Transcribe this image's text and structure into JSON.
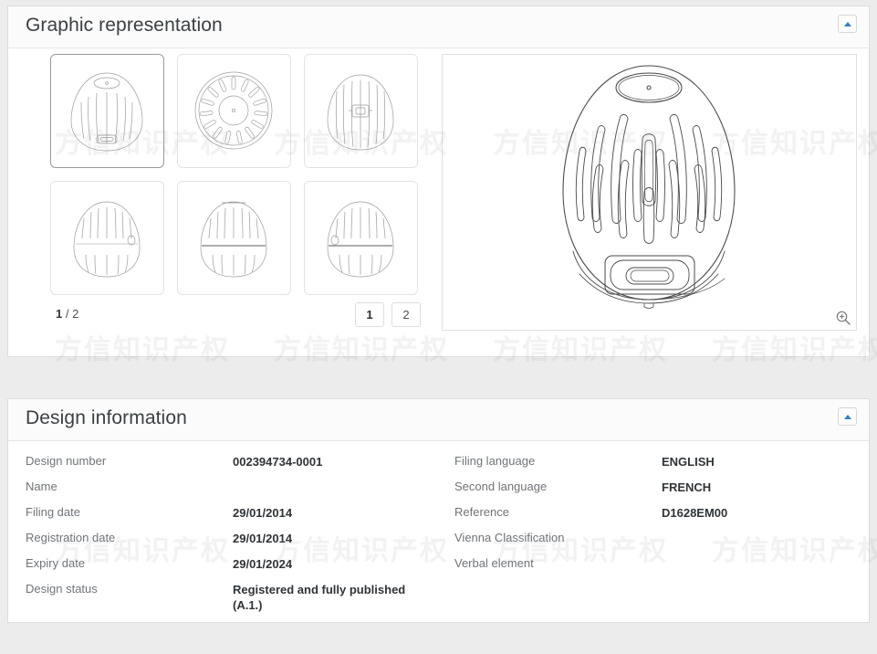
{
  "watermark": {
    "text": "方信知识产权"
  },
  "graphic_panel": {
    "title": "Graphic representation",
    "collapse_icon": "caret-up-icon",
    "page_count_current": "1",
    "page_count_separator": " / ",
    "page_count_total": "2",
    "pager": [
      {
        "label": "1",
        "active": true
      },
      {
        "label": "2",
        "active": false
      }
    ],
    "zoom_icon": "magnifier-plus-icon",
    "thumbnails": [
      {
        "name": "thumbnail-1-perspective-view",
        "selected": true,
        "view": "perspective"
      },
      {
        "name": "thumbnail-2-top-view",
        "selected": false,
        "view": "top"
      },
      {
        "name": "thumbnail-3-front-view",
        "selected": false,
        "view": "front"
      },
      {
        "name": "thumbnail-4-side-view",
        "selected": false,
        "view": "side"
      },
      {
        "name": "thumbnail-5-back-view",
        "selected": false,
        "view": "back"
      },
      {
        "name": "thumbnail-6-other-side-view",
        "selected": false,
        "view": "side2"
      }
    ],
    "main_image_alt": "design-drawing-egg-shaped-device-perspective"
  },
  "design_panel": {
    "title": "Design information",
    "collapse_icon": "caret-up-icon",
    "left_fields": [
      {
        "label": "Design number",
        "value": "002394734-0001"
      },
      {
        "label": "Name",
        "value": ""
      },
      {
        "label": "Filing date",
        "value": "29/01/2014"
      },
      {
        "label": "Registration date",
        "value": "29/01/2014"
      },
      {
        "label": "Expiry date",
        "value": "29/01/2024"
      },
      {
        "label": "Design status",
        "value": "Registered and fully published (A.1.)"
      }
    ],
    "right_fields": [
      {
        "label": "Filing language",
        "value": "ENGLISH"
      },
      {
        "label": "Second language",
        "value": "FRENCH"
      },
      {
        "label": "Reference",
        "value": "D1628EM00"
      },
      {
        "label": "Vienna Classification",
        "value": ""
      },
      {
        "label": "Verbal element",
        "value": ""
      }
    ]
  },
  "colors": {
    "page_background": "#ececec",
    "panel_background": "#ffffff",
    "panel_header_background": "#fbfbfb",
    "border": "#dcdcdc",
    "title_text": "#3b4044",
    "label_text": "#6f7479",
    "value_text": "#2f3438",
    "accent": "#2f7fc4"
  }
}
